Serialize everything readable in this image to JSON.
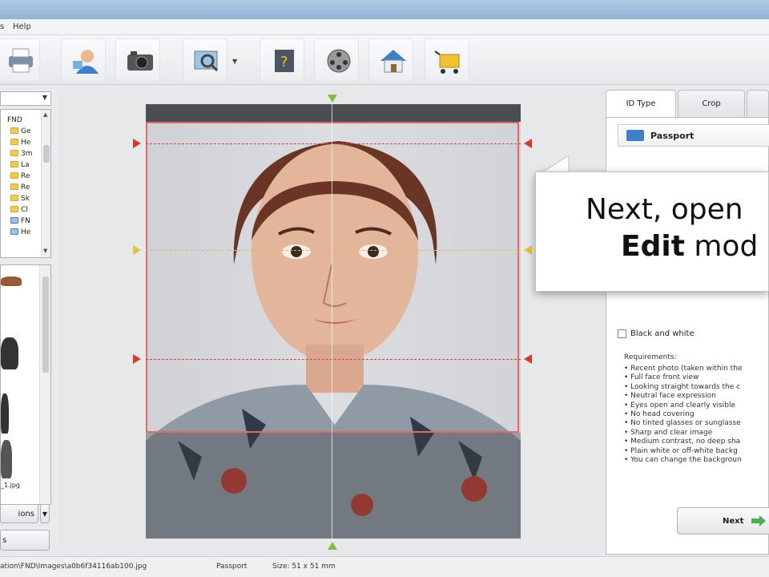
{
  "menu": {
    "help": "Help"
  },
  "toolbar": {
    "buttons": [
      "printer-icon",
      "user-icon",
      "camera-icon",
      "photo-search-icon",
      "help-book-icon",
      "film-reel-icon",
      "home-icon",
      "shopping-cart-icon"
    ]
  },
  "left_panel": {
    "tree": [
      {
        "label": "FND"
      },
      {
        "label": "Ge"
      },
      {
        "label": "He"
      },
      {
        "label": "3m"
      },
      {
        "label": "La"
      },
      {
        "label": "Re"
      },
      {
        "label": "Re"
      },
      {
        "label": "Sk"
      },
      {
        "label": "Cl"
      },
      {
        "label": "FN"
      },
      {
        "label": "He"
      }
    ],
    "thumb_filename": "_1.jpg",
    "options_label": "ions",
    "bottom_button": "s"
  },
  "right_panel": {
    "tabs": [
      "ID Type",
      "Crop"
    ],
    "id_type": "Passport",
    "black_and_white": "Black and white",
    "requirements_title": "Requirements:",
    "requirements": [
      "Recent photo (taken within the",
      "Full face front view",
      "Looking straight towards the c",
      "Neutral face expression",
      "Eyes open and clearly visible",
      "No head covering",
      "No tinted glasses or sunglasse",
      "Sharp and clear image",
      "Medium contrast, no deep sha",
      "Plain white or off-white backg",
      "You can change the backgroun"
    ],
    "next_label": "Next"
  },
  "callout": {
    "line1": "Next, open",
    "line2_bold": "Edit",
    "line2_rest": " mod"
  },
  "statusbar": {
    "path": "ation\\FND\\Images\\a0b6f34116ab100.jpg",
    "type": "Passport",
    "size": "Size: 51 x 51 mm"
  }
}
